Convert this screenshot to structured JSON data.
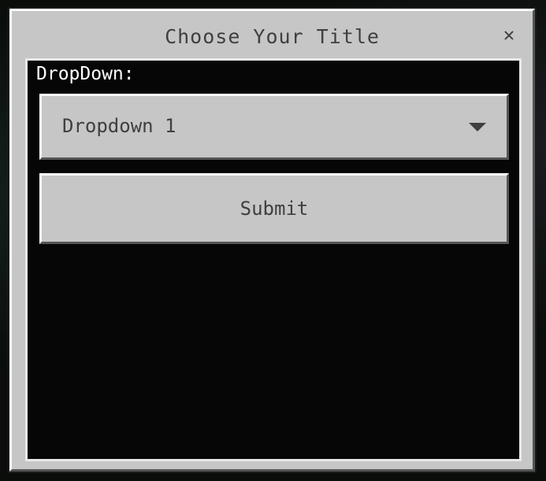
{
  "dialog": {
    "title": "Choose Your Title",
    "close_glyph": "✕",
    "close_icon": "close-icon"
  },
  "form": {
    "dropdown_label": "DropDown:",
    "dropdown_value": "Dropdown 1",
    "dropdown_icon": "chevron-down-icon",
    "submit_label": "Submit"
  },
  "colors": {
    "panel": "#c6c6c6",
    "content_bg": "#060606",
    "text_dark": "#3f3f3f",
    "text_light": "#ffffff"
  }
}
